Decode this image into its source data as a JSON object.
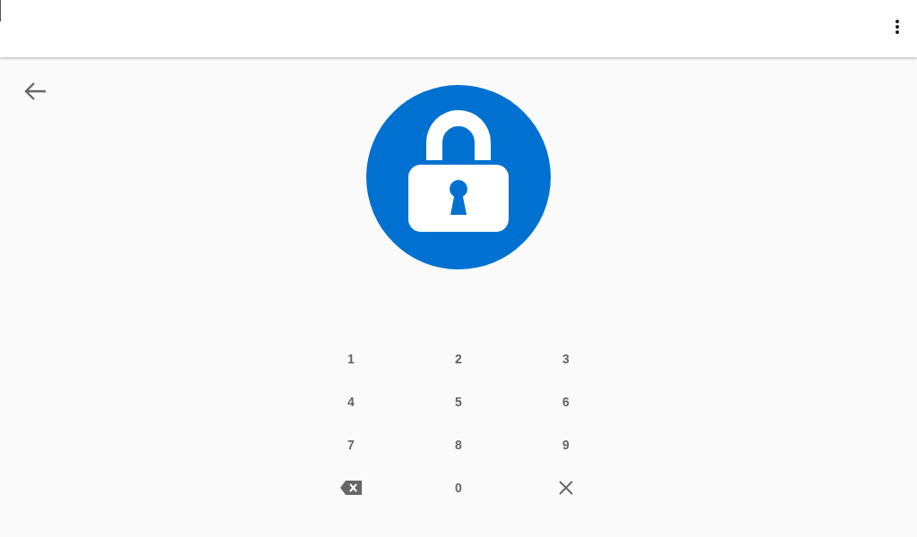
{
  "pin_field": {
    "focused": true
  },
  "keypad": [
    {
      "kind": "digit",
      "label": "1"
    },
    {
      "kind": "digit",
      "label": "2"
    },
    {
      "kind": "digit",
      "label": "3"
    },
    {
      "kind": "digit",
      "label": "4"
    },
    {
      "kind": "digit",
      "label": "5"
    },
    {
      "kind": "digit",
      "label": "6"
    },
    {
      "kind": "digit",
      "label": "7"
    },
    {
      "kind": "digit",
      "label": "8"
    },
    {
      "kind": "digit",
      "label": "9"
    },
    {
      "kind": "backspace"
    },
    {
      "kind": "digit",
      "label": "0"
    },
    {
      "kind": "clear"
    }
  ]
}
